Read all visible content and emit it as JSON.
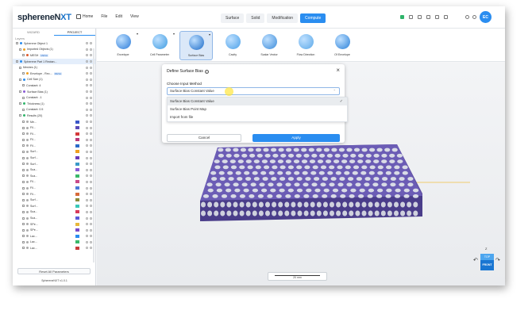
{
  "app": {
    "logo_main": "sphereneN",
    "logo_accent": "XT",
    "version": "SphereneNXT v1.0.1"
  },
  "menu": [
    "Home",
    "File",
    "Edit",
    "View"
  ],
  "modes": [
    {
      "label": "Surface",
      "active": false
    },
    {
      "label": "Solid",
      "active": false
    },
    {
      "label": "Modification",
      "active": false
    },
    {
      "label": "Compute",
      "active": true
    }
  ],
  "user": {
    "initials": "EC"
  },
  "left_panel": {
    "tabs": [
      "WIZARD",
      "PROJECT"
    ],
    "section_label": "Layers",
    "reset_label": "Reset All Parameters",
    "tree": [
      {
        "label": "Spherene Object 1",
        "indent": 1,
        "dot": "#2a8df0"
      },
      {
        "label": "Imported Objects (1)",
        "indent": 2,
        "dot": "#f0a020"
      },
      {
        "label": "MESH",
        "indent": 3,
        "dot": "#e05a2a",
        "tag": "MESH"
      },
      {
        "label": "Spherene Part 1 Rectan...",
        "indent": 1,
        "dot": "#2a8df0",
        "hl": true
      },
      {
        "label": "Meshes (1)",
        "indent": 2,
        "dot": ""
      },
      {
        "label": "Envelope - Rec...",
        "indent": 3,
        "dot": "#f0a020",
        "tag": "MESH"
      },
      {
        "label": "Cell Size (1)",
        "indent": 2,
        "dot": "#2a8df0"
      },
      {
        "label": "Constant: 4",
        "indent": 3,
        "dot": ""
      },
      {
        "label": "Surface Bias (1)",
        "indent": 2,
        "dot": "#8a5ad6"
      },
      {
        "label": "Constant: -1",
        "indent": 3,
        "dot": ""
      },
      {
        "label": "Thickness (1)",
        "indent": 2,
        "dot": "#2fb46a"
      },
      {
        "label": "Constant: 0.5",
        "indent": 3,
        "dot": ""
      },
      {
        "label": "Results (20)",
        "indent": 2,
        "dot": "#2fb46a"
      },
      {
        "label": "Me...",
        "indent": 3,
        "dot": "#aaa",
        "swatch": "#3a56c8"
      },
      {
        "label": "Fil...",
        "indent": 3,
        "dot": "#aaa",
        "swatch": "#5a4ab8"
      },
      {
        "label": "Fil...",
        "indent": 3,
        "dot": "#aaa",
        "swatch": "#d43a3a"
      },
      {
        "label": "Fil...",
        "indent": 3,
        "dot": "#aaa",
        "swatch": "#b83a7a"
      },
      {
        "label": "Fil...",
        "indent": 3,
        "dot": "#aaa",
        "swatch": "#2a6ac8"
      },
      {
        "label": "Surf...",
        "indent": 3,
        "dot": "#aaa",
        "swatch": "#f0a020"
      },
      {
        "label": "Surf...",
        "indent": 3,
        "dot": "#aaa",
        "swatch": "#6a3ab8"
      },
      {
        "label": "Surf...",
        "indent": 3,
        "dot": "#aaa",
        "swatch": "#3a9ac8"
      },
      {
        "label": "Sca...",
        "indent": 3,
        "dot": "#aaa",
        "swatch": "#8a5ad6"
      },
      {
        "label": "Sca...",
        "indent": 3,
        "dot": "#aaa",
        "swatch": "#3ab86a"
      },
      {
        "label": "Fil...",
        "indent": 3,
        "dot": "#aaa",
        "swatch": "#c84a8a"
      },
      {
        "label": "Fil...",
        "indent": 3,
        "dot": "#aaa",
        "swatch": "#4a7ad8"
      },
      {
        "label": "Fil...",
        "indent": 3,
        "dot": "#aaa",
        "swatch": "#d86a3a"
      },
      {
        "label": "Surf...",
        "indent": 3,
        "dot": "#aaa",
        "swatch": "#8a8a3a"
      },
      {
        "label": "Surf...",
        "indent": 3,
        "dot": "#aaa",
        "swatch": "#3ac8b8"
      },
      {
        "label": "Sca...",
        "indent": 3,
        "dot": "#aaa",
        "swatch": "#d83a5a"
      },
      {
        "label": "Sca...",
        "indent": 3,
        "dot": "#aaa",
        "swatch": "#5a5ad8"
      },
      {
        "label": "SPe...",
        "indent": 3,
        "dot": "#aaa",
        "swatch": "#e8b83a"
      },
      {
        "label": "SPe...",
        "indent": 3,
        "dot": "#aaa",
        "swatch": "#7a4ac8"
      },
      {
        "label": "Lac...",
        "indent": 3,
        "dot": "#aaa",
        "swatch": "#2a8df0"
      },
      {
        "label": "Lac...",
        "indent": 3,
        "dot": "#aaa",
        "swatch": "#3ab86a"
      },
      {
        "label": "Lac...",
        "indent": 3,
        "dot": "#aaa",
        "swatch": "#c83a3a"
      }
    ]
  },
  "ribbon": [
    {
      "label": "Envelope",
      "color": "#2a7ad8",
      "selected": false
    },
    {
      "label": "Cell Parameter",
      "color": "#3a9ae0",
      "selected": false
    },
    {
      "label": "Surface Bias",
      "color": "#1a6ac8",
      "selected": true
    },
    {
      "label": "Cavity",
      "color": "#4aa0e8",
      "selected": false
    },
    {
      "label": "Scalar Vector",
      "color": "#3a8ad8",
      "selected": false
    },
    {
      "label": "Flow Direction",
      "color": "#5aa8e8",
      "selected": false
    },
    {
      "label": "Of Envelope",
      "color": "#2a80d8",
      "selected": false
    }
  ],
  "dialog": {
    "title": "Define Surface Bias",
    "label": "Choose Input Method",
    "selected_value": "Surface Bias Constant Value",
    "options": [
      "Surface Bias Constant Value",
      "Surface Bias Point Map",
      "Import from file"
    ],
    "cancel_label": "Cancel",
    "apply_label": "Apply"
  },
  "viewport": {
    "scale_label": "20 mm",
    "viewcube_top": "TOP",
    "viewcube_front": "FRONT",
    "viewcube_axis": "Z"
  },
  "colors": {
    "accent": "#2a8df0",
    "lattice": "#5e4fa0"
  }
}
